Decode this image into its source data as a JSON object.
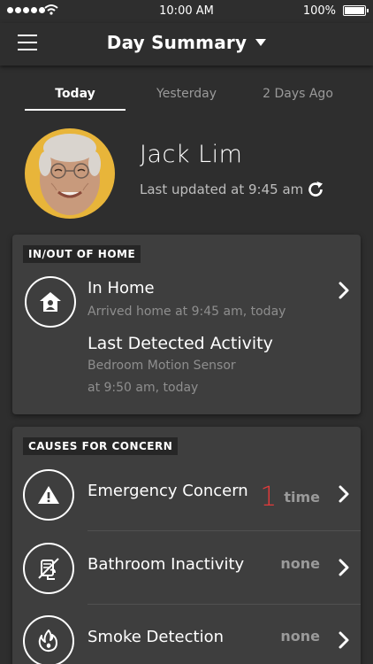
{
  "status_bar": {
    "time": "10:00 AM",
    "battery": "100%"
  },
  "nav": {
    "title": "Day Summary"
  },
  "tabs": [
    {
      "label": "Today"
    },
    {
      "label": "Yesterday"
    },
    {
      "label": "2 Days Ago"
    }
  ],
  "profile": {
    "name": "Jack Lim",
    "updated": "Last updated at 9:45 am"
  },
  "in_out": {
    "label": "IN/OUT OF HOME",
    "status": "In Home",
    "status_detail": "Arrived home at 9:45 am, today",
    "activity_title": "Last Detected Activity",
    "activity_sensor": "Bedroom Motion Sensor",
    "activity_time": "at 9:50 am, today"
  },
  "concerns": {
    "label": "CAUSES FOR CONCERN",
    "items": [
      {
        "label": "Emergency Concern",
        "count": "1",
        "unit": "time",
        "icon": "warning-icon"
      },
      {
        "label": "Bathroom Inactivity",
        "count": "",
        "unit": "none",
        "icon": "bathroom-inactivity-icon"
      },
      {
        "label": "Smoke Detection",
        "count": "",
        "unit": "none",
        "icon": "smoke-icon"
      }
    ]
  },
  "colors": {
    "background": "#2e2e2e",
    "card": "#3e3e3e",
    "alert": "#e23b3b",
    "avatar_bg": "#e8b53a"
  }
}
